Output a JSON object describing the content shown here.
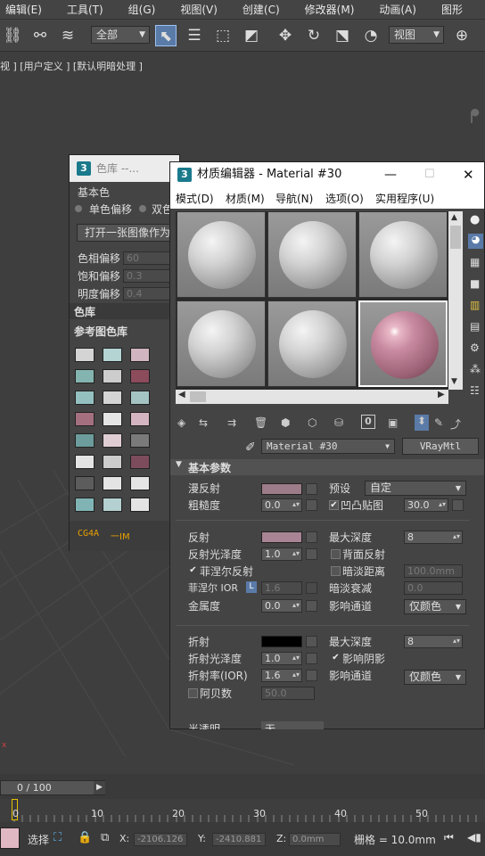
{
  "menu": [
    "编辑(E)",
    "工具(T)",
    "组(G)",
    "视图(V)",
    "创建(C)",
    "修改器(M)",
    "动画(A)",
    "图形"
  ],
  "toolbar": {
    "selection_filter": "全部",
    "ref_coord": "视图"
  },
  "viewport": {
    "label": "视 ] [用户定义 ] [默认明暗处理 ]"
  },
  "colorlib": {
    "title": "色库 --...",
    "section_base": "基本色",
    "radio_mono": "单色偏移",
    "radio_dual": "双色",
    "open_image_button": "打开一张图像作为",
    "hue_label": "色相偏移",
    "hue_value": "60",
    "sat_label": "饱和偏移",
    "sat_value": "0.3",
    "bri_label": "明度偏移",
    "bri_value": "0.4",
    "section_lib": "色库",
    "section_ref": "参考图色库",
    "footer_left": "CG4A",
    "footer_right": "一IM",
    "swatches": [
      [
        "#d4d4d4",
        "#b4d4d4",
        "#d0b4c0"
      ],
      [
        "#84b4b0",
        "#cdcdcd",
        "#8c4c5c"
      ],
      [
        "#94c0c0",
        "#d4d4d4",
        "#a4c4c4"
      ],
      [
        "#a47080",
        "#e4e4e4",
        "#d4b4c0"
      ],
      [
        "#6c9c9c",
        "#e0cdd4",
        "#7a7a7a"
      ],
      [
        "#e4e4e4",
        "#cccccc",
        "#7c4c5c"
      ],
      [
        "#5c5c5c",
        "#e4e4e4",
        "#e4e4e4"
      ],
      [
        "#80b4b4",
        "#b4d0d0",
        "#e4e4e4"
      ]
    ]
  },
  "mated": {
    "title": "材质编辑器 - Material #30",
    "menu": [
      "模式(D)",
      "材质(M)",
      "导航(N)",
      "选项(O)",
      "实用程序(U)"
    ],
    "material_name": "Material #30",
    "material_type": "VRayMtl",
    "rollout_basic": "基本参数",
    "diffuse_label": "漫反射",
    "roughness_label": "粗糙度",
    "roughness_value": "0.0",
    "preset_label": "预设",
    "preset_value": "自定",
    "bump_label": "凹凸贴图",
    "bump_value": "30.0",
    "reflect_label": "反射",
    "max_depth_label": "最大深度",
    "max_depth_value": "8",
    "refl_gloss_label": "反射光泽度",
    "refl_gloss_value": "1.0",
    "backside_label": "背面反射",
    "fresnel_label": "菲涅尔反射",
    "dim_dist_label": "暗淡距离",
    "dim_dist_value": "100.0mm",
    "fresnel_ior_label": "菲涅尔 IOR",
    "fresnel_ior_value": "1.6",
    "l_badge": "L",
    "dim_falloff_label": "暗淡衰减",
    "dim_falloff_value": "0.0",
    "metal_label": "金属度",
    "metal_value": "0.0",
    "affect_ch_label": "影响通道",
    "affect_ch_value": "仅颜色",
    "refract_label": "折射",
    "refr_depth_label": "最大深度",
    "refr_depth_value": "8",
    "refr_gloss_label": "折射光泽度",
    "refr_gloss_value": "1.0",
    "affect_shadow_label": "影响阴影",
    "ior_label": "折射率(IOR)",
    "ior_value": "1.6",
    "refr_affect_label": "影响通道",
    "refr_affect_value": "仅颜色",
    "abbe_label": "阿贝数",
    "abbe_value": "50.0",
    "translucent_label": "半透明",
    "translucent_value": "无",
    "colors": {
      "diffuse": "#9c7c88",
      "reflect": "#a88494",
      "refract": "#000000"
    }
  },
  "timeline": {
    "frame_display": "0 / 100",
    "ticks": [
      "0",
      "10",
      "20",
      "30",
      "40",
      "50"
    ]
  },
  "status": {
    "select_label": "选择",
    "x_label": "X:",
    "x_value": "-2106.126",
    "y_label": "Y:",
    "y_value": "-2410.881",
    "z_label": "Z:",
    "z_value": "0.0mm",
    "grid_label": "栅格 = 10.0mm"
  }
}
